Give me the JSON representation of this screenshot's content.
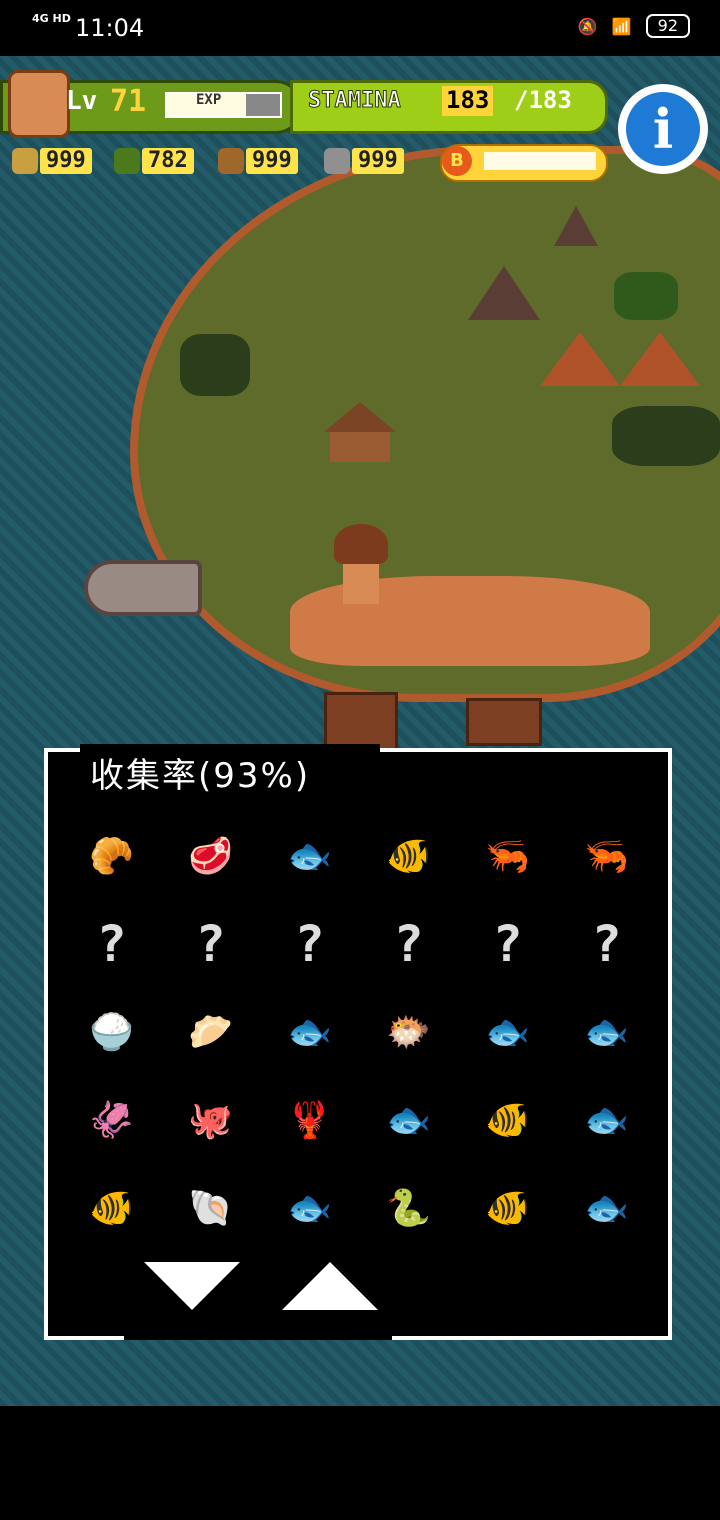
{
  "status_bar": {
    "network": "4G HD",
    "time": "11:04",
    "battery": "92",
    "icons": [
      "notifications-off-icon",
      "wifi-icon",
      "battery-icon"
    ]
  },
  "hud": {
    "level_label": "Lv",
    "level_value": "71",
    "exp_label": "EXP",
    "exp_progress_percent": 70,
    "stamina_label": "STAMINA",
    "stamina_current": "183",
    "stamina_max": "/183",
    "resources": [
      {
        "name": "branch-icon",
        "value": "999"
      },
      {
        "name": "leaf-icon",
        "value": "782"
      },
      {
        "name": "acorn-icon",
        "value": "999"
      },
      {
        "name": "stone-icon",
        "value": "999"
      }
    ],
    "coin_label": "B",
    "info_label": "i"
  },
  "collection_panel": {
    "title": "收集率(93%)",
    "items": [
      "🥐",
      "🥩",
      "🐟",
      "🐠",
      "🦐",
      "🦐",
      "?",
      "?",
      "?",
      "?",
      "?",
      "?",
      "🍚",
      "🥟",
      "🐟",
      "🐡",
      "🐟",
      "🐟",
      "🦑",
      "🐙",
      "🦞",
      "🐟",
      "🐠",
      "🐟",
      "🐠",
      "🐚",
      "🐟",
      "🐍",
      "🐠",
      "🐟"
    ],
    "nav": [
      "down-arrow",
      "up-arrow"
    ]
  },
  "colors": {
    "ocean": "#235b68",
    "grass": "#5e6b2a",
    "shore": "#b05a2d",
    "stamina": "#9fce18",
    "level": "#6d9a18",
    "info": "#1f7ad6"
  }
}
